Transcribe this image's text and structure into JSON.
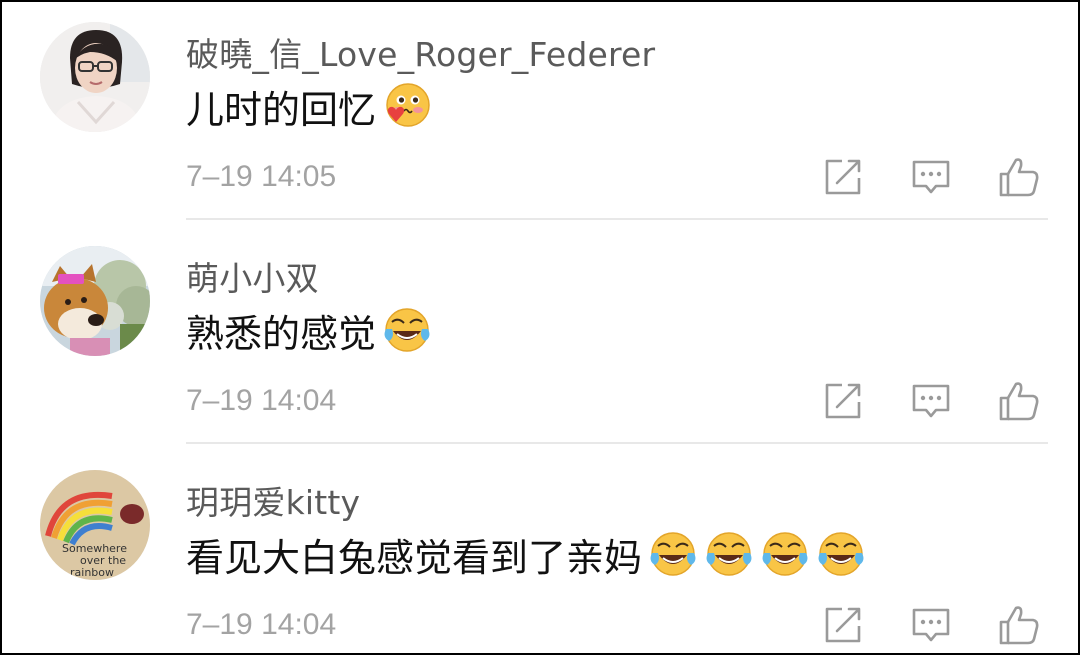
{
  "comments": [
    {
      "username": "破曉_信_Love_Roger_Federer",
      "text": "儿时的回忆",
      "emojis": [
        "blush-heart-emoji"
      ],
      "time": "7–19 14:05"
    },
    {
      "username": "萌小小双",
      "text": "熟悉的感觉",
      "emojis": [
        "laugh-cry-emoji"
      ],
      "time": "7–19 14:04"
    },
    {
      "username": "玥玥爱kitty",
      "text": "看见大白兔感觉看到了亲妈",
      "emojis": [
        "laugh-cry-emoji",
        "laugh-cry-emoji",
        "laugh-cry-emoji",
        "laugh-cry-emoji"
      ],
      "time": "7–19 14:04"
    }
  ],
  "avatars": {
    "comment1": "profile-photo-woman-glasses",
    "comment2": "profile-photo-shiba-dog",
    "comment3": "profile-photo-rainbow-note"
  },
  "avatar_text": {
    "comment3": [
      "Somewhere",
      "over the",
      "rainbow"
    ]
  },
  "icons": {
    "share": "share-edit-icon",
    "reply": "comment-bubble-icon",
    "like": "thumbs-up-icon"
  },
  "colors": {
    "username": "#5a5a5a",
    "text": "#111111",
    "time": "#a3a3a3",
    "icon": "#9a9a9a",
    "divider": "#e8e8e8"
  }
}
